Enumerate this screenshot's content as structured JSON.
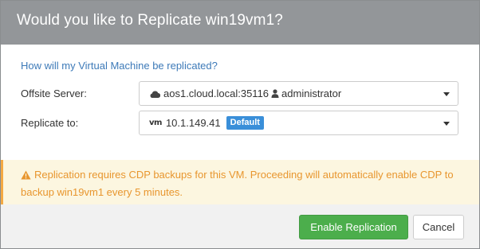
{
  "dialog": {
    "title": "Would you like to Replicate win19vm1?"
  },
  "form": {
    "question": "How will my Virtual Machine be replicated?",
    "offsite_server": {
      "label": "Offsite Server:",
      "server": "aos1.cloud.local:35116",
      "user": "administrator",
      "server_icon": "cloud-icon",
      "user_icon": "user-icon"
    },
    "replicate_to": {
      "label": "Replicate to:",
      "target": "10.1.149.41",
      "badge": "Default",
      "target_icon": "vm-icon"
    }
  },
  "alert": {
    "icon": "warning-icon",
    "text": "Replication requires CDP backups for this VM. Proceeding will automatically enable CDP to backup win19vm1 every 5 minutes."
  },
  "footer": {
    "enable_label": "Enable Replication",
    "cancel_label": "Cancel"
  },
  "colors": {
    "header": "#939699",
    "link": "#3d7ab8",
    "badge": "#3a8fd9",
    "warning": "#e8962e",
    "warning_bg": "#fcf6e0",
    "primary_button": "#4cae4c"
  }
}
